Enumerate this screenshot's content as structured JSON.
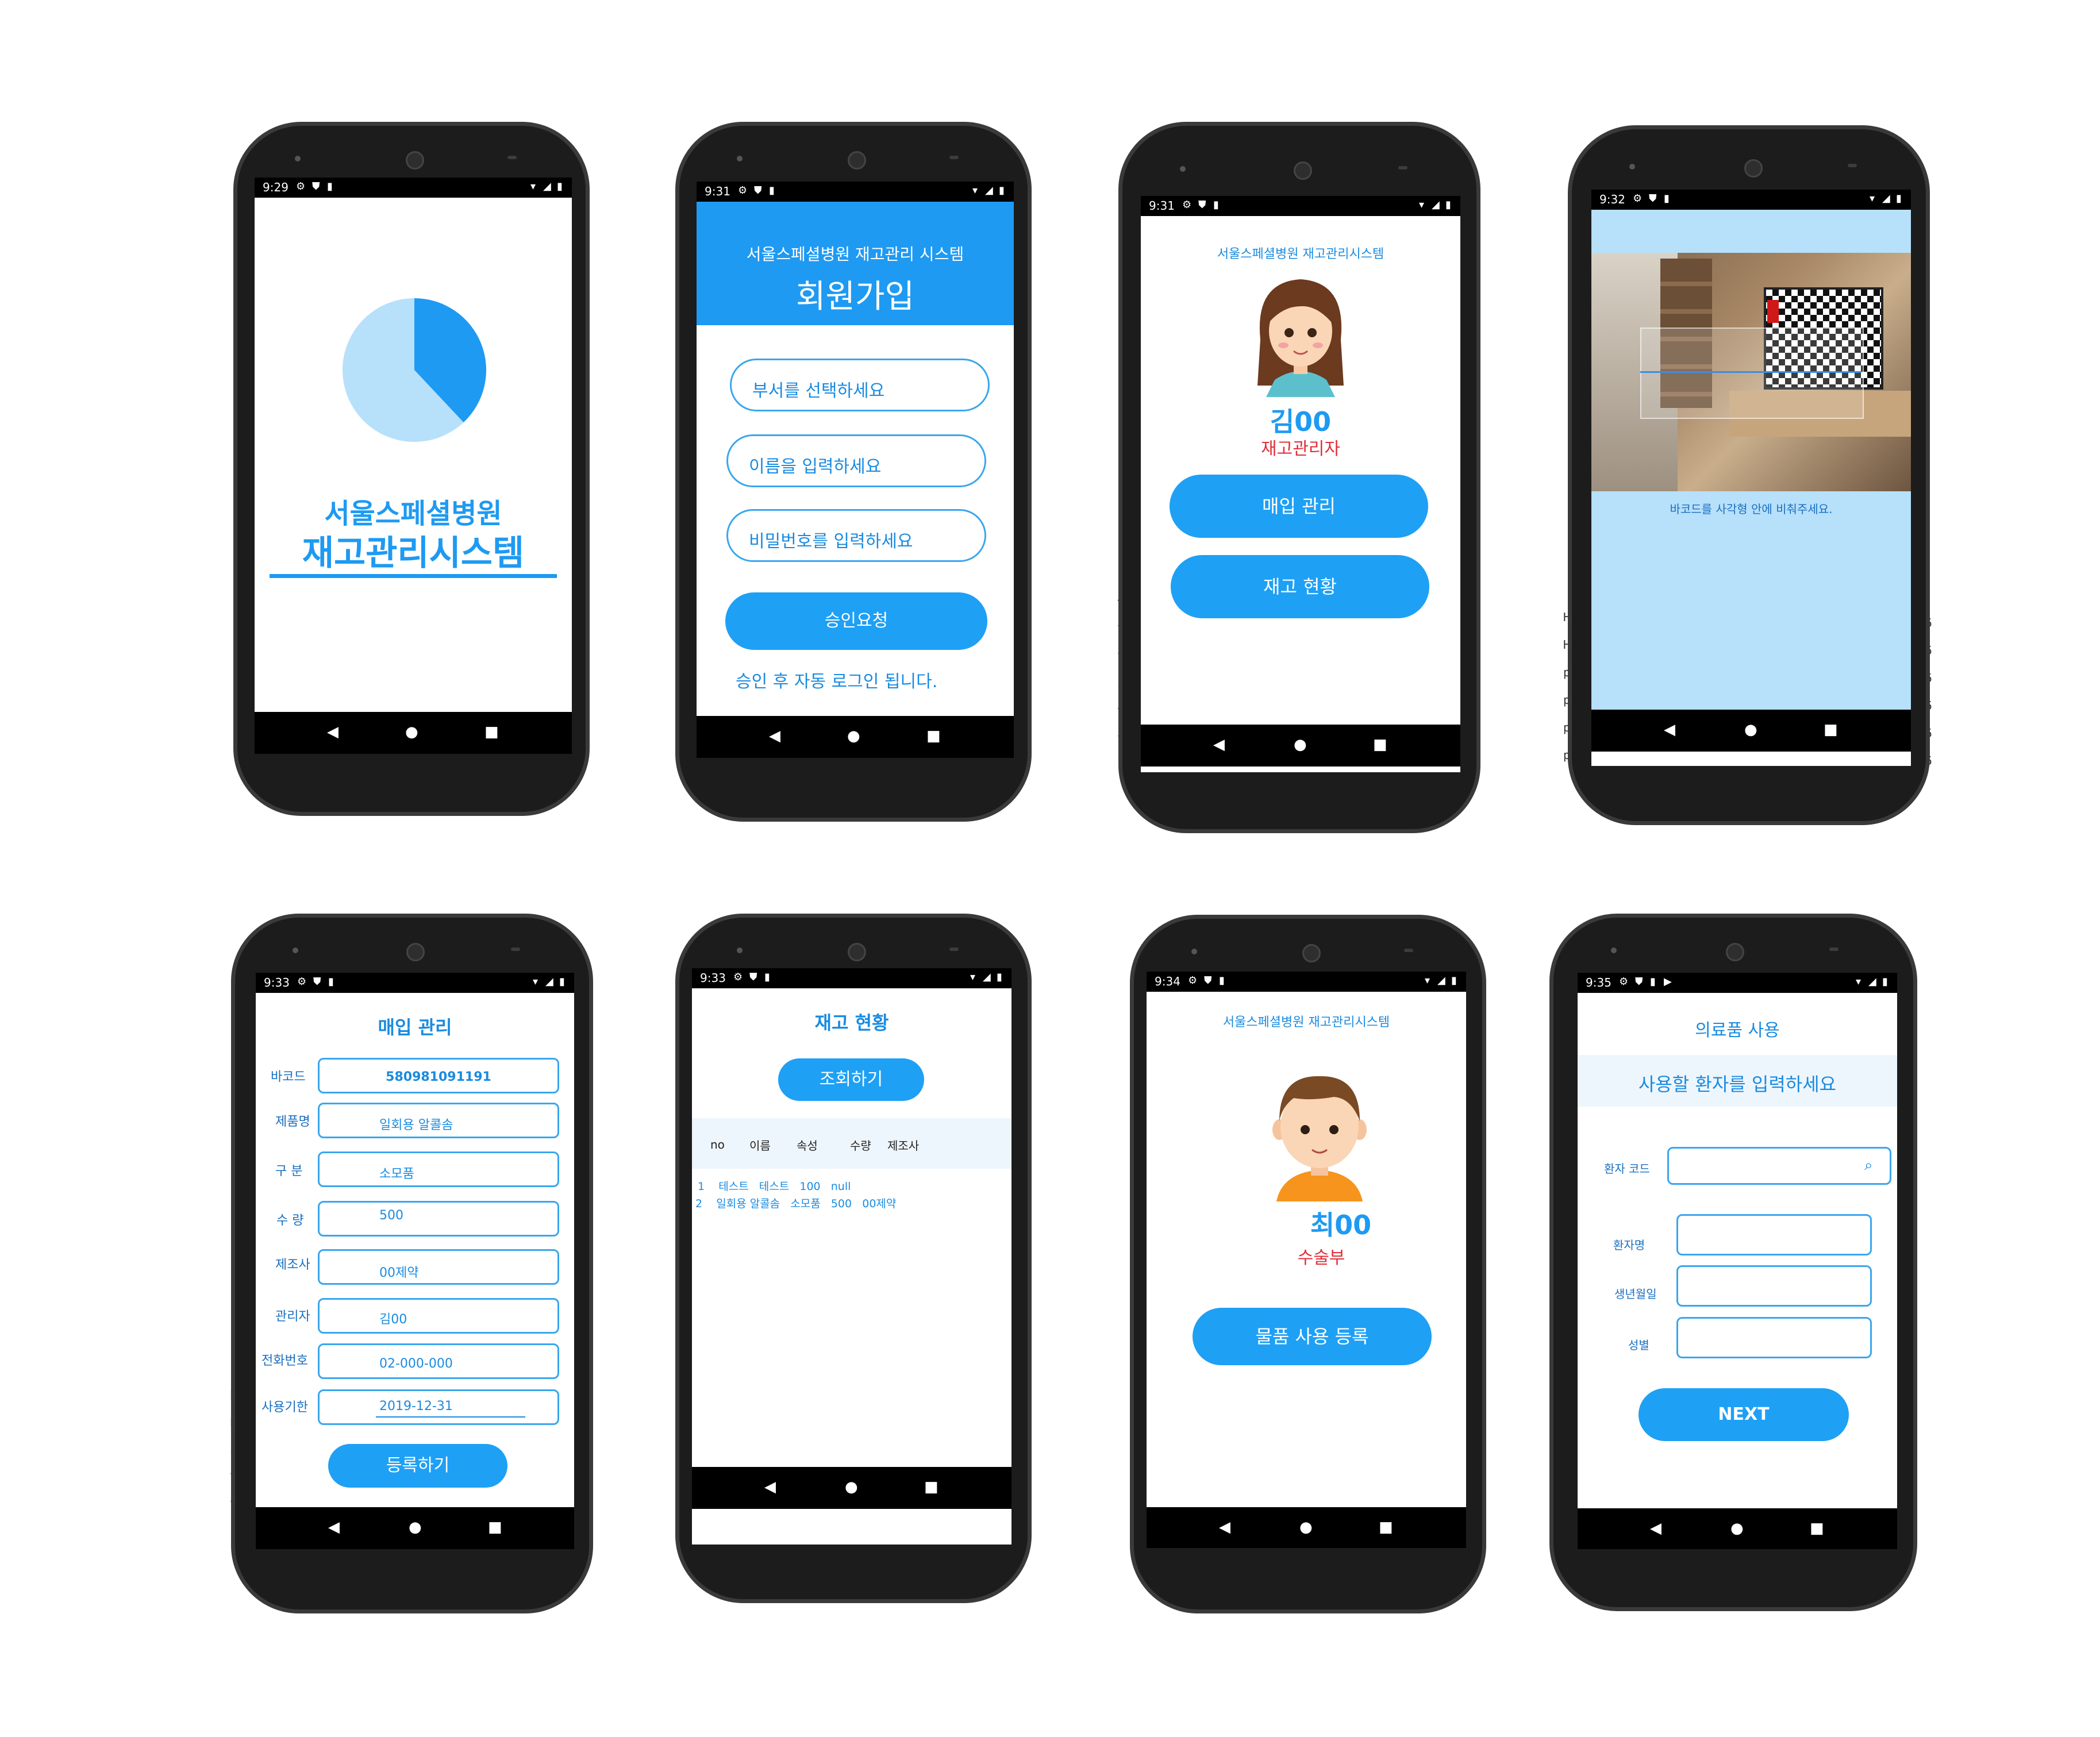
{
  "colors": {
    "accent": "#1ea0f5",
    "light_blue": "#b7e0fb",
    "red_role": "#e0303a",
    "text_blue": "#1a8be0"
  },
  "screens": {
    "splash": {
      "time": "9:29",
      "hospital": "서울스페셜병원",
      "system": "재고관리시스템",
      "chart_data": {
        "type": "pie",
        "values": [
          38,
          62
        ],
        "colors": [
          "#1e9af2",
          "#b7e0fb"
        ]
      }
    },
    "signup": {
      "time": "9:31",
      "header_sub": "서울스페셜병원 재고관리 시스템",
      "header_title": "회원가입",
      "dept_placeholder": "부서를 선택하세요",
      "name_placeholder": "이름을 입력하세요",
      "password_placeholder": "비밀번호를 입력하세요",
      "submit_label": "승인요청",
      "note": "승인 후 자동 로그인 됩니다."
    },
    "home_manager": {
      "time": "9:31",
      "system_title": "서울스페셜병원 재고관리시스템",
      "user_name": "김00",
      "user_role": "재고관리자",
      "btn_purchase": "매입 관리",
      "btn_stock": "재고 현황"
    },
    "scanner": {
      "time": "9:32",
      "instruction": "바코드를 사각형 안에 비춰주세요."
    },
    "purchase": {
      "time": "9:33",
      "title": "매입 관리",
      "fields": [
        {
          "label": "바코드",
          "value": "580981091191"
        },
        {
          "label": "제품명",
          "value": "일회용 알콜솜"
        },
        {
          "label": "구 분",
          "value": "소모품"
        },
        {
          "label": "수 량",
          "value": "500"
        },
        {
          "label": "제조사",
          "value": "00제약"
        },
        {
          "label": "관리자",
          "value": "김00"
        },
        {
          "label": "전화번호",
          "value": "02-000-000"
        },
        {
          "label": "사용기한",
          "value": "2019-12-31"
        }
      ],
      "submit_label": "등록하기"
    },
    "stock": {
      "time": "9:33",
      "title": "재고 현황",
      "query_label": "조회하기",
      "headers": [
        "no",
        "이름",
        "속성",
        "수량",
        "제조사"
      ],
      "rows": [
        "1    테스트   테스트   100   null",
        "2    일회용 알콜솜   소모품   500   00제약"
      ]
    },
    "home_surgery": {
      "time": "9:34",
      "system_title": "서울스페셜병원 재고관리시스템",
      "user_name": "최00",
      "user_role": "수술부",
      "btn_register": "물품 사용 등록"
    },
    "supply_use": {
      "time": "9:35",
      "title": "의료품 사용",
      "prompt": "사용할 환자를 입력하세요",
      "patient_code_label": "환자 코드",
      "patient_name_label": "환자명",
      "birth_label": "생년월일",
      "gender_label": "성별",
      "next_label": "NEXT"
    }
  }
}
